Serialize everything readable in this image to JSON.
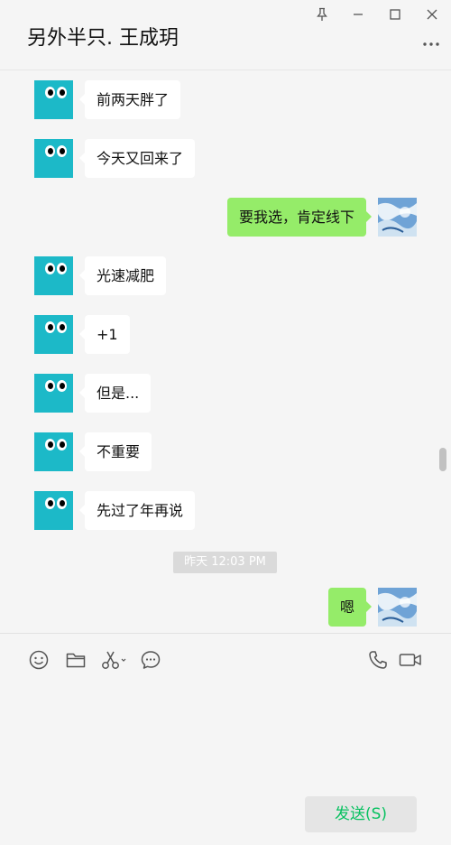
{
  "window": {
    "title": "另外半只. 王成玥",
    "controls": [
      "pin-icon",
      "minimize-icon",
      "maximize-icon",
      "close-icon"
    ]
  },
  "messages": [
    {
      "side": "left",
      "text": "前两天胖了"
    },
    {
      "side": "left",
      "text": "今天又回来了"
    },
    {
      "side": "right",
      "text": "要我选，肯定线下"
    },
    {
      "side": "left",
      "text": "光速减肥"
    },
    {
      "side": "left",
      "text": "+1"
    },
    {
      "side": "left",
      "text": "但是..."
    },
    {
      "side": "left",
      "text": "不重要"
    },
    {
      "side": "left",
      "text": "先过了年再说"
    },
    {
      "side": "right",
      "text": "嗯"
    }
  ],
  "timestamp": "昨天 12:03 PM",
  "toolbar": {
    "left_tools": [
      "emoji-icon",
      "folder-icon",
      "scissors-icon",
      "chat-bubble-icon"
    ],
    "right_tools": [
      "phone-icon",
      "video-icon"
    ]
  },
  "input": {
    "value": "",
    "placeholder": ""
  },
  "send_label": "发送(S)",
  "colors": {
    "background": "#f5f5f5",
    "incoming_bubble": "#ffffff",
    "outgoing_bubble": "#95ec69",
    "avatar": "#1cb9c8",
    "send_text": "#07c160"
  }
}
